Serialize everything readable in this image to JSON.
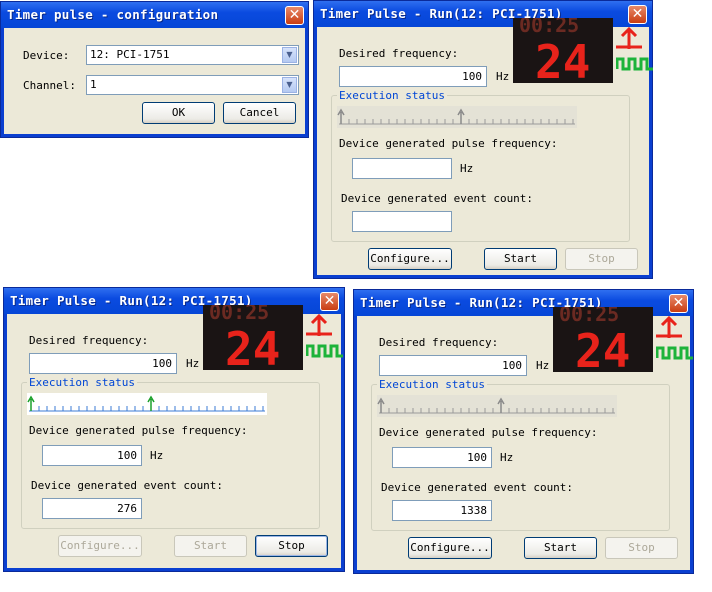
{
  "config_dialog": {
    "title": "Timer pulse - configuration",
    "device_label": "Device:",
    "device_value": "12: PCI-1751",
    "channel_label": "Channel:",
    "channel_value": "1",
    "ok_label": "OK",
    "cancel_label": "Cancel"
  },
  "run_windows": [
    {
      "title": "Timer Pulse - Run(12: PCI-1751)",
      "desired_frequency_label": "Desired frequency:",
      "desired_frequency_value": "100",
      "hz_label": "Hz",
      "execution_status_label": "Execution status",
      "pulse_frequency_label": "Device generated pulse frequency:",
      "pulse_frequency_value": "",
      "pulse_hz_label": "Hz",
      "event_count_label": "Device generated event count:",
      "event_count_value": "",
      "configure_label": "Configure...",
      "start_label": "Start",
      "stop_label": "Stop",
      "state": {
        "configure_enabled": true,
        "start_enabled": true,
        "stop_enabled": false,
        "track_active": false
      },
      "clock": {
        "top_digits": "00:25",
        "main_digits": "24"
      }
    },
    {
      "title": "Timer Pulse - Run(12: PCI-1751)",
      "desired_frequency_label": "Desired frequency:",
      "desired_frequency_value": "100",
      "hz_label": "Hz",
      "execution_status_label": "Execution status",
      "pulse_frequency_label": "Device generated pulse frequency:",
      "pulse_frequency_value": "100",
      "pulse_hz_label": "Hz",
      "event_count_label": "Device generated event count:",
      "event_count_value": "276",
      "configure_label": "Configure...",
      "start_label": "Start",
      "stop_label": "Stop",
      "state": {
        "configure_enabled": false,
        "start_enabled": false,
        "stop_enabled": true,
        "track_active": true
      },
      "clock": {
        "top_digits": "00:25",
        "main_digits": "24"
      }
    },
    {
      "title": "Timer Pulse - Run(12: PCI-1751)",
      "desired_frequency_label": "Desired frequency:",
      "desired_frequency_value": "100",
      "hz_label": "Hz",
      "execution_status_label": "Execution status",
      "pulse_frequency_label": "Device generated pulse frequency:",
      "pulse_frequency_value": "100",
      "pulse_hz_label": "Hz",
      "event_count_label": "Device generated event count:",
      "event_count_value": "1338",
      "configure_label": "Configure...",
      "start_label": "Start",
      "stop_label": "Stop",
      "state": {
        "configure_enabled": true,
        "start_enabled": true,
        "stop_enabled": false,
        "track_active": false
      },
      "clock": {
        "top_digits": "00:25",
        "main_digits": "24"
      }
    }
  ],
  "icons": {
    "close": "close-icon",
    "dropdown": "chevron-down-icon",
    "pulse": "pulse-signal-icon",
    "clock": "digital-clock-icon"
  },
  "colors": {
    "titlebar": "#0546d6",
    "face": "#ece9d8",
    "group_label": "#0046d5",
    "clock_digits": "#e8231b",
    "pulse_red": "#e8231b",
    "pulse_green": "#1db33a",
    "active_marker": "#1aa02a",
    "inactive_marker": "#8a8a8a"
  }
}
